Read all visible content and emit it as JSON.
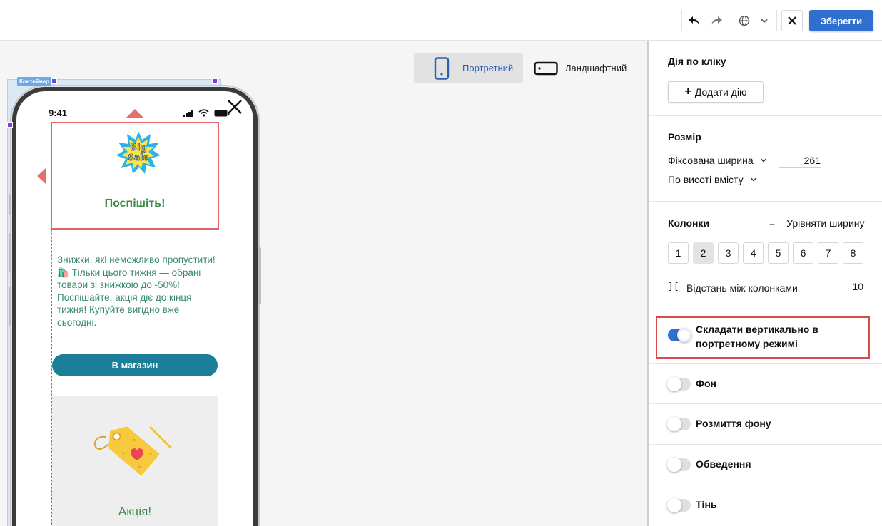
{
  "topbar": {
    "undo_icon": "undo-arrow",
    "redo_icon": "redo-arrow",
    "language_icon": "globe",
    "close_icon": "close-x",
    "save_label": "Зберегти",
    "colors": {
      "save": "#2f6fd0"
    }
  },
  "canvas": {
    "orientation_tabs": [
      {
        "label": "Портретний",
        "icon": "phone-portrait",
        "active": true
      },
      {
        "label": "Ландшафтний",
        "icon": "phone-landscape",
        "active": false
      }
    ],
    "container_label": "Контейнер",
    "phone": {
      "time": "9:41",
      "close_icon": "close-x",
      "badge_text": "Big Sale",
      "headline": "Поспішіть!",
      "body": "Знижки, які неможливо пропустити! 🛍️ Тільки цього тижня — обрані товари зі знижкою до -50%! Поспішайте, акція діє до кінця тижня! Купуйте вигідно вже сьогодні.",
      "button_label": "В магазин",
      "promo_text": "Акція!",
      "colors": {
        "headline": "#3b8a4a",
        "body": "#3a8a6a",
        "button": "#1c7f99"
      }
    }
  },
  "panel": {
    "click_action": {
      "title": "Дія по кліку",
      "add_label": "Додати дію"
    },
    "size": {
      "title": "Розмір",
      "width_mode": "Фіксована ширина",
      "width_value": "261",
      "height_mode": "По висоті вмісту"
    },
    "columns": {
      "title": "Колонки",
      "equalize_icon": "equals",
      "equalize_label": "Урівняти ширину",
      "options": [
        "1",
        "2",
        "3",
        "4",
        "5",
        "6",
        "7",
        "8"
      ],
      "selected": "2",
      "gap_label": "Відстань між колонками",
      "gap_value": "10"
    },
    "toggles": [
      {
        "label_line1": "Складати вертикально в",
        "label_line2": "портретному режимі",
        "on": true
      },
      {
        "label": "Фон",
        "on": false
      },
      {
        "label": "Розмиття фону",
        "on": false
      },
      {
        "label": "Обведення",
        "on": false
      },
      {
        "label": "Тінь",
        "on": false
      }
    ]
  }
}
